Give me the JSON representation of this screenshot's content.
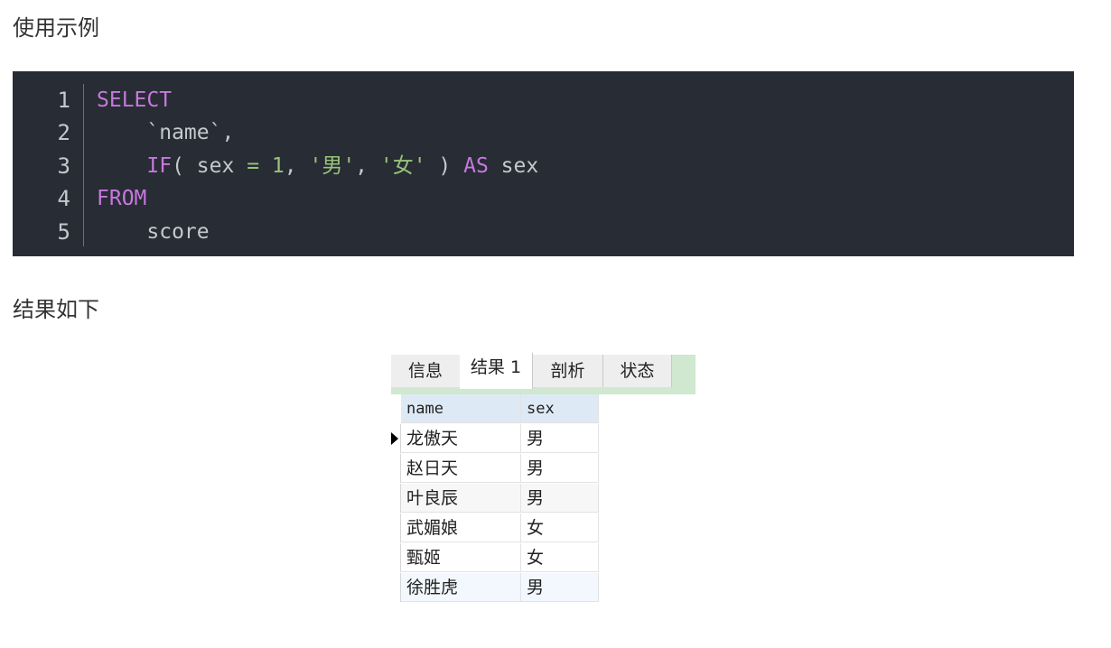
{
  "headings": {
    "example": "使用示例",
    "result": "结果如下"
  },
  "code": {
    "line_numbers": [
      "1",
      "2",
      "3",
      "4",
      "5"
    ],
    "lines": [
      [
        {
          "t": "SELECT",
          "c": "kw"
        }
      ],
      [
        {
          "t": "    `name`,",
          "c": ""
        }
      ],
      [
        {
          "t": "    ",
          "c": ""
        },
        {
          "t": "IF",
          "c": "kw"
        },
        {
          "t": "( sex ",
          "c": ""
        },
        {
          "t": "=",
          "c": "op"
        },
        {
          "t": " ",
          "c": ""
        },
        {
          "t": "1",
          "c": "num"
        },
        {
          "t": ", ",
          "c": ""
        },
        {
          "t": "'男'",
          "c": "str"
        },
        {
          "t": ", ",
          "c": ""
        },
        {
          "t": "'女'",
          "c": "str"
        },
        {
          "t": " ) ",
          "c": ""
        },
        {
          "t": "AS",
          "c": "kw"
        },
        {
          "t": " sex",
          "c": ""
        }
      ],
      [
        {
          "t": "FROM",
          "c": "kw"
        }
      ],
      [
        {
          "t": "    score",
          "c": ""
        }
      ]
    ],
    "colors": {
      "background": "#282c34",
      "keyword": "#c678dd",
      "literal": "#98c379",
      "plain": "#c5c8ce"
    }
  },
  "result_panel": {
    "tabs": [
      "信息",
      "结果 1",
      "剖析",
      "状态"
    ],
    "active_tab": "结果 1",
    "columns": [
      "name",
      "sex"
    ],
    "rows": [
      [
        "龙傲天",
        "男"
      ],
      [
        "赵日天",
        "男"
      ],
      [
        "叶良辰",
        "男"
      ],
      [
        "武媚娘",
        "女"
      ],
      [
        "甄姬",
        "女"
      ],
      [
        "徐胜虎",
        "男"
      ]
    ]
  }
}
